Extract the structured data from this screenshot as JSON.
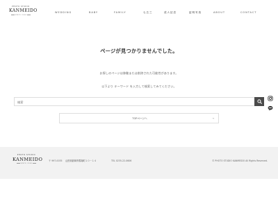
{
  "header": {
    "logo_arc": "PHOTO STUDIO",
    "logo_main": "KANMEIDO",
    "logo_sub": "SINCE 2006",
    "nav": [
      "WEDDING",
      "BABY",
      "FAMILY",
      "七五三",
      "成人記念",
      "証明写真",
      "ABOUT",
      "CONTACT"
    ]
  },
  "main": {
    "title": "ページが見つかりませんでした。",
    "message_1": "お探しのページは移動または削除された可能性があります。",
    "message_2": "以下より キーワード を入力して検索してみてください。",
    "search_placeholder": "検索",
    "top_link_label": "TOPページへ",
    "top_link_arrow": "→"
  },
  "side_icons": [
    "instagram-icon",
    "line-icon"
  ],
  "footer": {
    "logo_arc": "PHOTO STUDIO",
    "logo_main": "KANMEIDO",
    "logo_sub": "SINCE 2006",
    "postal": "〒 997-0035",
    "address": "山形県鶴岡市馬場町１０－１４",
    "tel": "TEL 0235-22-0606",
    "copyright": "© PHOTO STUDIO KANMEIDO All Rights Reserved."
  },
  "colors": {
    "search_button": "#4a4a4a",
    "footer_bg": "#f2f2f2",
    "icon": "#333333"
  }
}
